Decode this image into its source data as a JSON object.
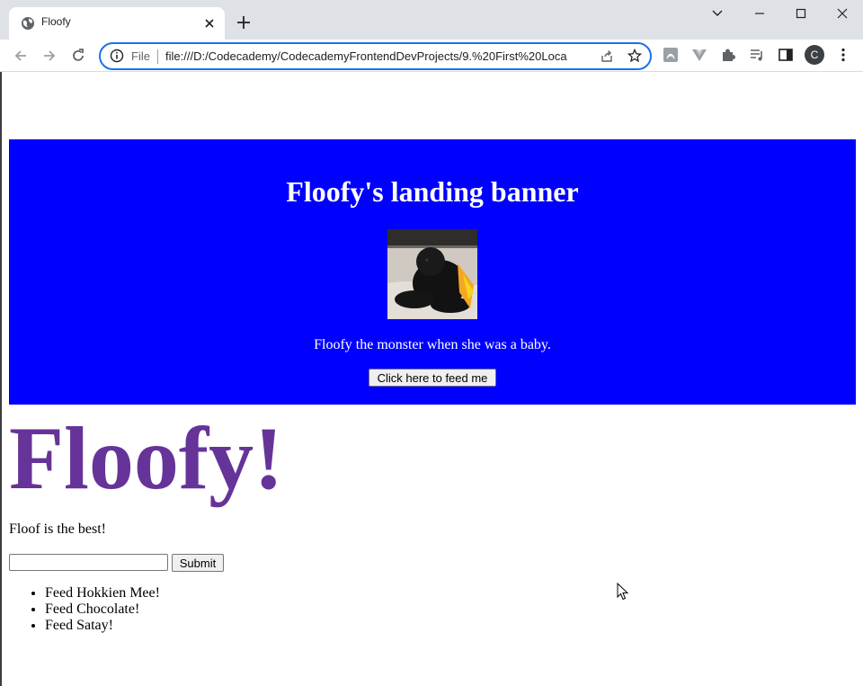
{
  "browser": {
    "tab_title": "Floofy",
    "address_scheme_label": "File",
    "url": "file:///D:/Codecademy/CodecademyFrontendDevProjects/9.%20First%20Loca",
    "profile_initial": "C",
    "accent_color": "#1a73e8",
    "icons": [
      "globe-icon",
      "close-icon",
      "plus-icon",
      "chevron-down-icon",
      "minimize-icon",
      "maximize-icon",
      "window-close-icon",
      "back-icon",
      "forward-icon",
      "reload-icon",
      "info-icon",
      "share-icon",
      "star-icon",
      "pdf-extension-icon",
      "vue-extension-icon",
      "puzzle-icon",
      "media-icon",
      "side-panel-icon",
      "more-vert-icon"
    ]
  },
  "page": {
    "banner": {
      "title": "Floofy's landing banner",
      "caption": "Floofy the monster when she was a baby.",
      "button_label": "Click here to feed me",
      "background_color": "#0000ff"
    },
    "heading": "Floofy!",
    "heading_color": "#663399",
    "tagline": "Floof is the best!",
    "input_value": "",
    "submit_label": "Submit",
    "feed_items": [
      "Feed Hokkien Mee!",
      "Feed Chocolate!",
      "Feed Satay!"
    ]
  }
}
